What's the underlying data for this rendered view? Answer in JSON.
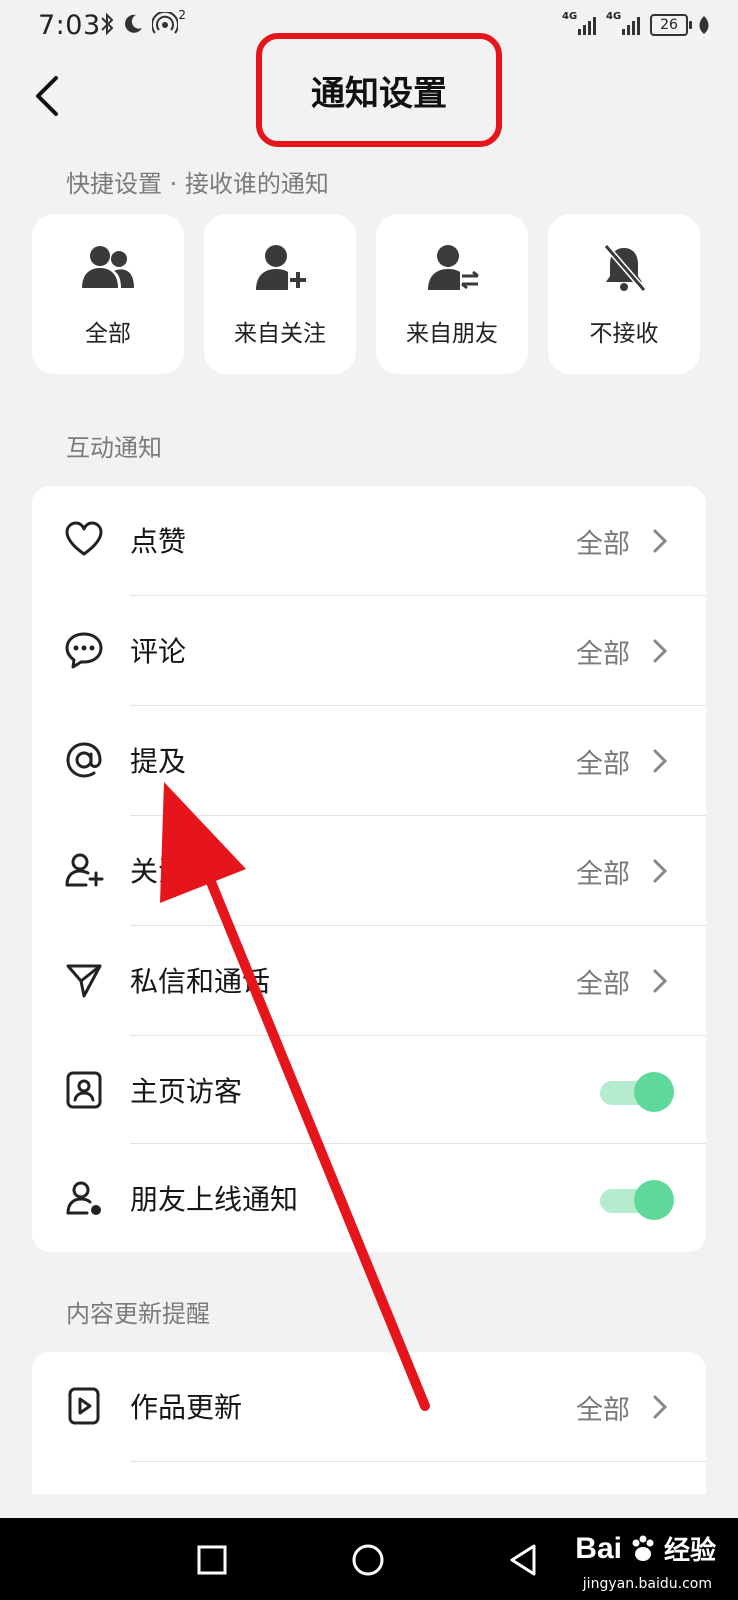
{
  "status_bar": {
    "time": "7:03",
    "hotspot_count": "2",
    "network_labels": [
      "4G",
      "4G"
    ],
    "battery": "26"
  },
  "header": {
    "title": "通知设置"
  },
  "quick_settings": {
    "section_label": "快捷设置 · 接收谁的通知",
    "options": [
      {
        "label": "全部",
        "icon": "people-icon"
      },
      {
        "label": "来自关注",
        "icon": "person-add-icon"
      },
      {
        "label": "来自朋友",
        "icon": "person-swap-icon"
      },
      {
        "label": "不接收",
        "icon": "bell-off-icon"
      }
    ]
  },
  "interaction": {
    "section_label": "互动通知",
    "rows": [
      {
        "label": "点赞",
        "value": "全部",
        "icon": "heart-icon"
      },
      {
        "label": "评论",
        "value": "全部",
        "icon": "comment-icon"
      },
      {
        "label": "提及",
        "value": "全部",
        "icon": "at-icon"
      },
      {
        "label": "关注",
        "value": "全部",
        "icon": "follow-icon"
      },
      {
        "label": "私信和通话",
        "value": "全部",
        "icon": "send-icon"
      },
      {
        "label": "主页访客",
        "toggle": true,
        "icon": "profile-card-icon"
      },
      {
        "label": "朋友上线通知",
        "toggle": true,
        "icon": "user-online-icon"
      }
    ]
  },
  "content_updates": {
    "section_label": "内容更新提醒",
    "rows": [
      {
        "label": "作品更新",
        "value": "全部",
        "icon": "video-icon"
      }
    ]
  },
  "colors": {
    "annotation_red": "#e6141b",
    "toggle_on_track": "#b5ecd0",
    "toggle_on_knob": "#5fd99a",
    "icon_dark": "#3a3a3a"
  },
  "watermark": {
    "logo": "Bai",
    "text": "经验",
    "url": "jingyan.baidu.com"
  }
}
